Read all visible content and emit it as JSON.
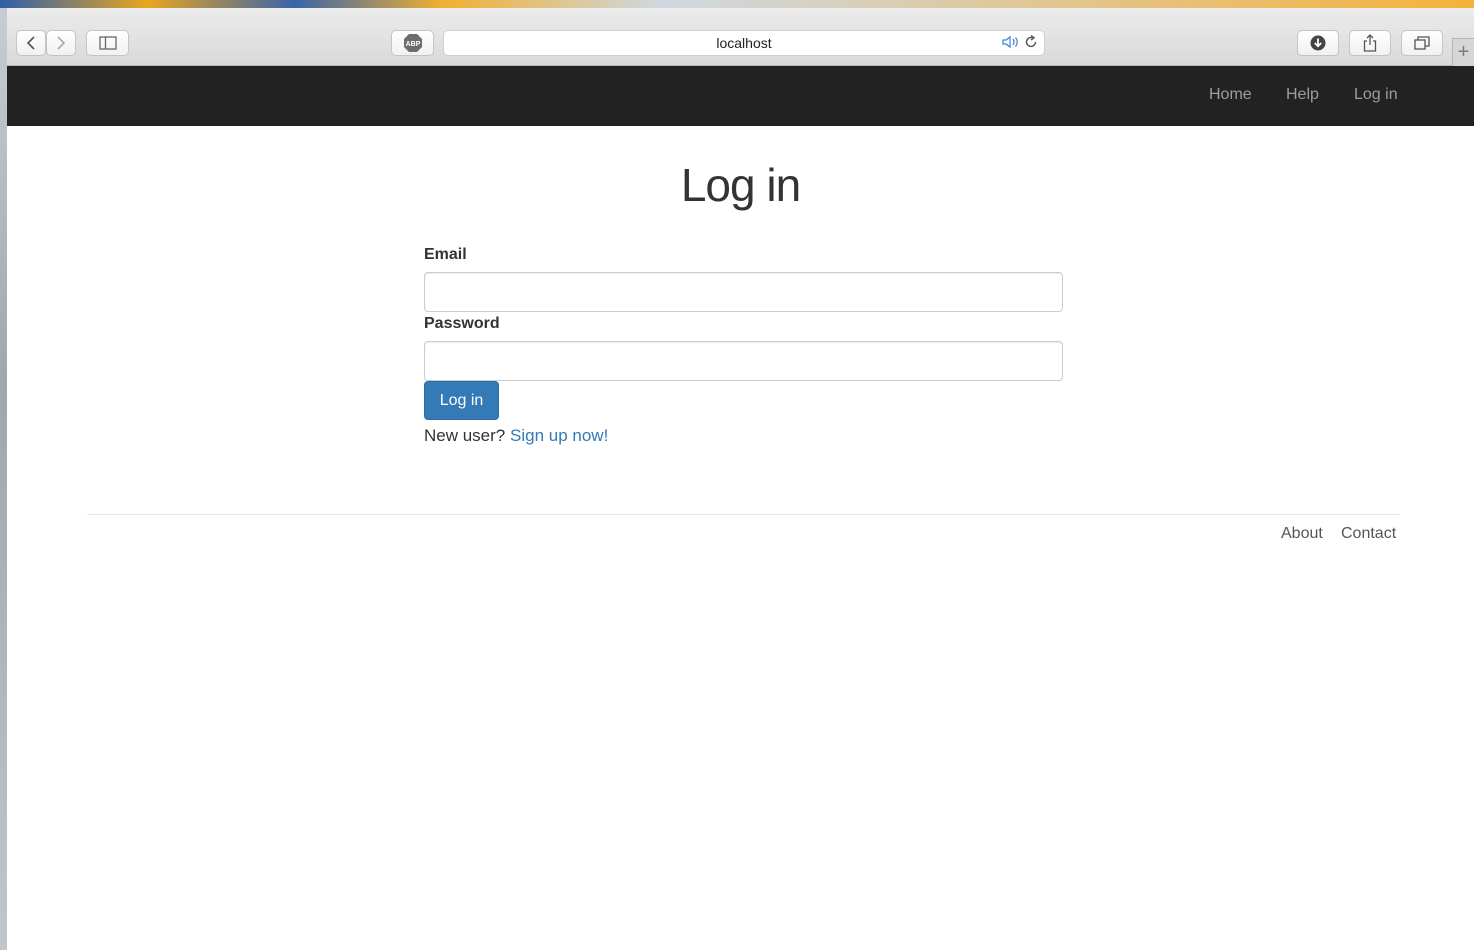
{
  "browser": {
    "url": "localhost",
    "icons": {
      "back": "chevron-left-icon",
      "forward": "chevron-right-icon",
      "sidebar": "sidebar-icon",
      "adblock": "abp-icon",
      "adblock_text": "ABP",
      "audio": "speaker-icon",
      "reload": "reload-icon",
      "download": "download-icon",
      "share": "share-icon",
      "tabs": "tabs-icon",
      "new_tab": "+"
    }
  },
  "nav": {
    "links": [
      "Home",
      "Help",
      "Log in"
    ]
  },
  "main": {
    "title": "Log in",
    "email_label": "Email",
    "email_value": "",
    "password_label": "Password",
    "password_value": "",
    "submit_label": "Log in",
    "new_user_text": "New user?",
    "signup_link": "Sign up now!"
  },
  "footer": {
    "links": [
      "About",
      "Contact"
    ]
  },
  "colors": {
    "navbar": "#222222",
    "primary": "#337ab7",
    "link": "#337ab7"
  }
}
